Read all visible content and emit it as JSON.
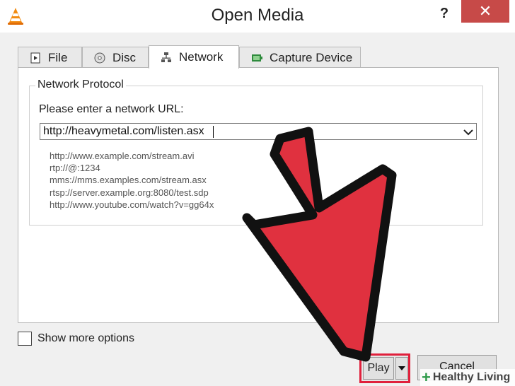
{
  "window": {
    "title": "Open Media",
    "help_label": "?",
    "close_label": "✕"
  },
  "tabs": [
    {
      "label": "File",
      "icon": "file-icon",
      "active": false
    },
    {
      "label": "Disc",
      "icon": "disc-icon",
      "active": false
    },
    {
      "label": "Network",
      "icon": "network-icon",
      "active": true
    },
    {
      "label": "Capture Device",
      "icon": "capture-device-icon",
      "active": false
    }
  ],
  "network": {
    "group_title": "Network Protocol",
    "prompt": "Please enter a network URL:",
    "url_value": "http://heavymetal.com/listen.asx",
    "examples": [
      "http://www.example.com/stream.avi",
      "rtp://@:1234",
      "mms://mms.examples.com/stream.asx",
      "rtsp://server.example.org:8080/test.sdp",
      "http://www.youtube.com/watch?v=gg64x"
    ]
  },
  "options": {
    "show_more_label": "Show more options",
    "show_more_checked": false
  },
  "buttons": {
    "play_label": "Play",
    "cancel_label": "Cancel"
  },
  "annotation": {
    "arrow_color": "#e0313f",
    "highlight_color": "#e0203c"
  },
  "watermark": {
    "text": "Healthy Living"
  },
  "colors": {
    "close_button": "#c74a48",
    "dialog_bg": "#f0f0f0"
  }
}
